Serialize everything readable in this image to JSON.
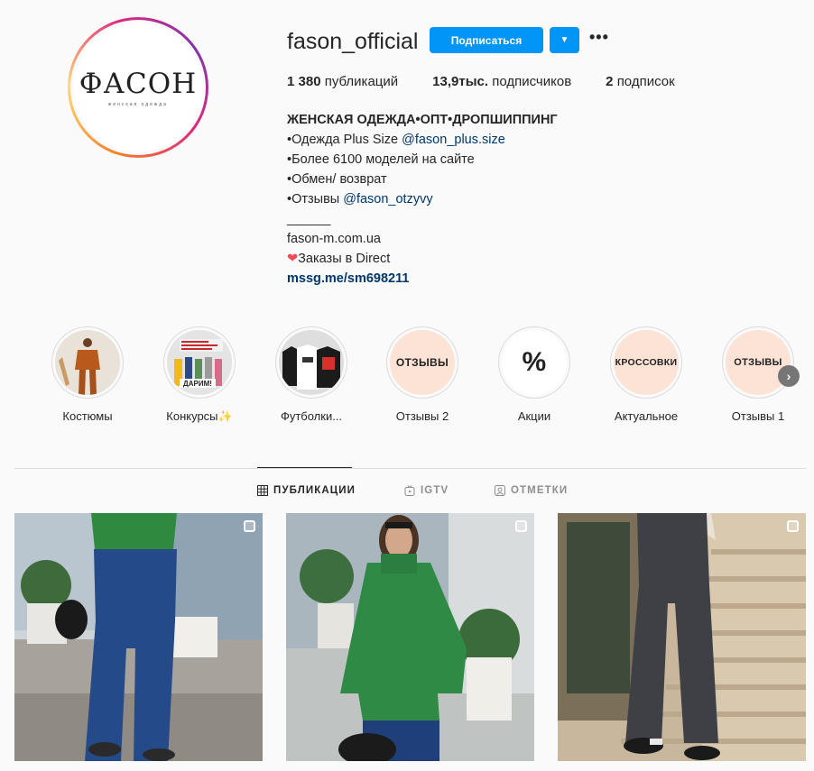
{
  "profile": {
    "username": "fason_official",
    "avatar_logo": "ФАСОН",
    "avatar_sub": "женская одежда",
    "follow_label": "Подписаться",
    "dropdown_icon": "caret-down-icon",
    "more_icon": "more-options-icon"
  },
  "stats": {
    "posts_count": "1 380",
    "posts_label": "публикаций",
    "followers_count": "13,9тыс.",
    "followers_label": "подписчиков",
    "following_count": "2",
    "following_label": "подписок"
  },
  "bio": {
    "title": "ЖЕНСКАЯ ОДЕЖДА•ОПТ•ДРОПШИППИНГ",
    "line1_text": "•Одежда Plus Size ",
    "line1_mention": "@fason_plus.size",
    "line2": "•Более 6100 моделей на сайте",
    "line3": "•Обмен/ возврат",
    "line4_text": "•Отзывы ",
    "line4_mention": "@fason_otzyvy",
    "separator": "______",
    "site": "fason-m.com.ua",
    "orders": "Заказы в Direct",
    "link": "mssg.me/sm698211"
  },
  "highlights": [
    {
      "label": "Костюмы",
      "type": "photo"
    },
    {
      "label": "Конкурсы✨",
      "type": "photo",
      "overlay_text": "ДАРИМ!"
    },
    {
      "label": "Футболки...",
      "type": "photo"
    },
    {
      "label": "Отзывы 2",
      "type": "text",
      "text": "ОТЗЫВЫ"
    },
    {
      "label": "Акции",
      "type": "text",
      "text": "%"
    },
    {
      "label": "Актуальное",
      "type": "text",
      "text": "КРОССОВКИ"
    },
    {
      "label": "Отзывы 1",
      "type": "text",
      "text": "ОТЗЫВЫ"
    }
  ],
  "tabs": {
    "posts": "ПУБЛИКАЦИИ",
    "igtv": "IGTV",
    "tagged": "ОТМЕТКИ"
  },
  "posts": [
    {
      "alt": "jeans-post-1"
    },
    {
      "alt": "green-sweater-post"
    },
    {
      "alt": "grey-jeans-post"
    }
  ],
  "colors": {
    "accent": "#0095f6",
    "link": "#00376b",
    "highlight_bg": "#fde3d6"
  }
}
